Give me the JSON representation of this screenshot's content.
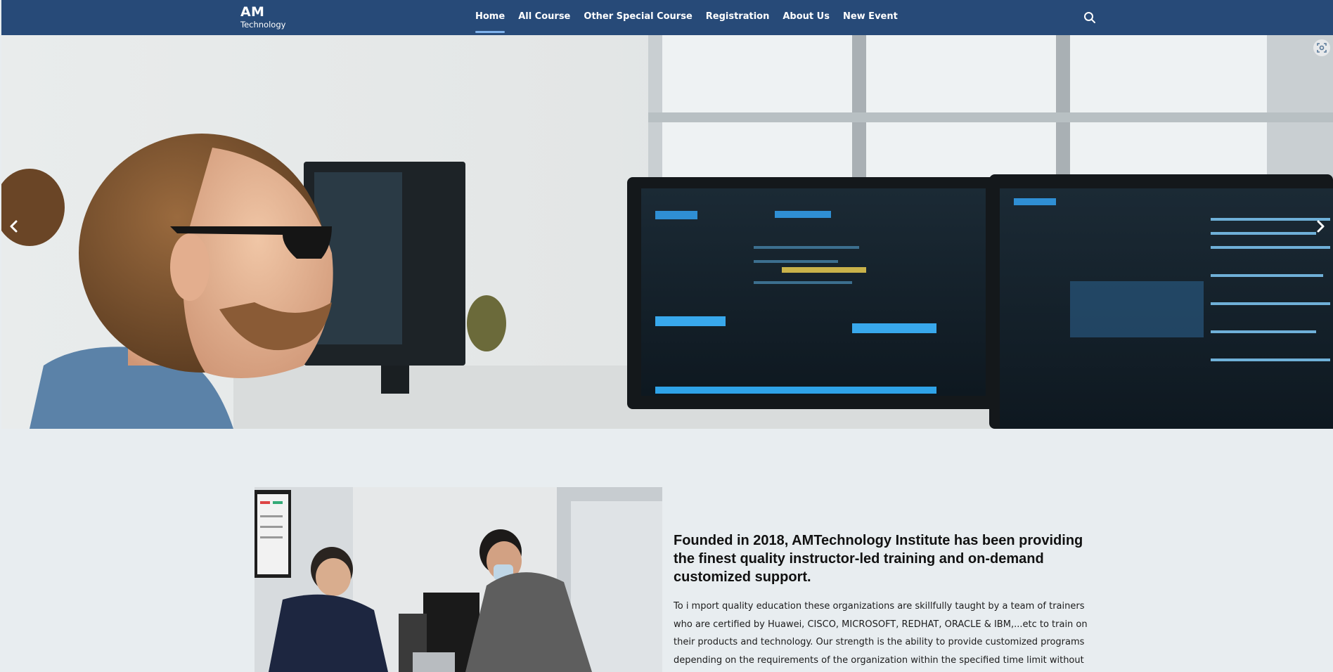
{
  "brand": {
    "name": "AM",
    "subtitle": "Technology"
  },
  "nav": {
    "items": [
      {
        "label": "Home",
        "active": true
      },
      {
        "label": "All Course",
        "active": false
      },
      {
        "label": "Other Special Course",
        "active": false
      },
      {
        "label": "Registration",
        "active": false
      },
      {
        "label": "About Us",
        "active": false
      },
      {
        "label": "New Event",
        "active": false
      }
    ],
    "search_icon": "search-icon"
  },
  "hero": {
    "prev_icon": "chevron-left-icon",
    "next_icon": "chevron-right-icon",
    "scan_icon": "scan-icon"
  },
  "about": {
    "heading": "Founded in 2018, AMTechnology Institute has been providing the finest quality instructor-led training and on-demand customized support.",
    "body": "To i mport quality education these organizations are skillfully taught by a team of trainers who are certified by Huawei, CISCO, MICROSOFT, REDHAT, ORACLE & IBM,...etc to train on their products and technology. Our strength is the ability to provide customized programs depending on the requirements of the organization within the specified time limit without"
  },
  "colors": {
    "header_bg": "#274a78",
    "active_underline": "#7fb2ec",
    "page_bg": "#e8edf0"
  }
}
